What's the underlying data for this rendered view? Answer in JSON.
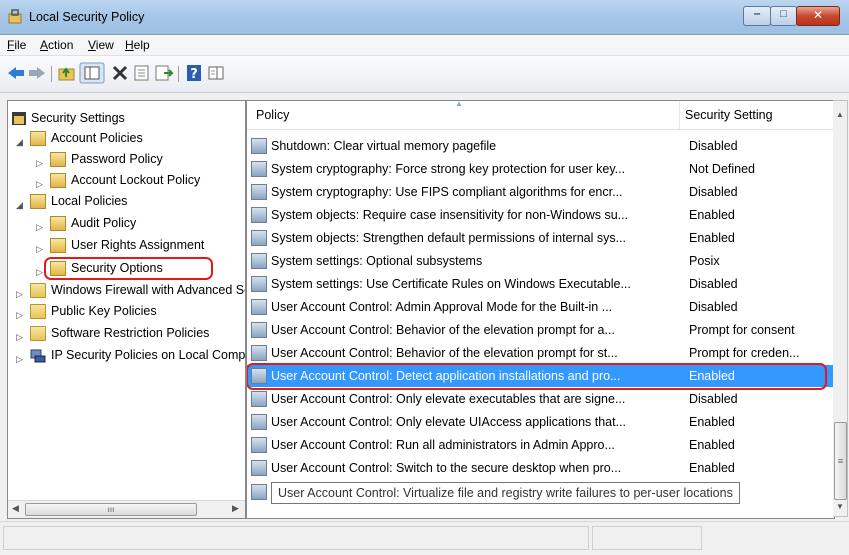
{
  "window": {
    "title": "Local Security Policy",
    "buttons": {
      "minimize": "‒",
      "maximize": "□",
      "close": "✕"
    }
  },
  "menu": [
    {
      "label": "File"
    },
    {
      "label": "Action"
    },
    {
      "label": "View"
    },
    {
      "label": "Help"
    }
  ],
  "toolbar": [
    {
      "icon": "back-arrow-icon"
    },
    {
      "icon": "forward-arrow-icon"
    },
    {
      "icon": "up-folder-icon"
    },
    {
      "icon": "show-hide-tree-icon"
    },
    {
      "icon": "delete-icon"
    },
    {
      "icon": "properties-icon"
    },
    {
      "icon": "export-list-icon"
    },
    {
      "icon": "help-icon"
    },
    {
      "icon": "show-hide-action-pane-icon"
    }
  ],
  "tree": [
    {
      "label": "Security Settings",
      "expander": ""
    },
    {
      "label": "Account Policies",
      "expander": "◢"
    },
    {
      "label": "Password Policy",
      "expander": "▷"
    },
    {
      "label": "Account Lockout Policy",
      "expander": "▷"
    },
    {
      "label": "Local Policies",
      "expander": "◢"
    },
    {
      "label": "Audit Policy",
      "expander": "▷"
    },
    {
      "label": "User Rights Assignment",
      "expander": "▷"
    },
    {
      "label": "Security Options",
      "expander": "▷"
    },
    {
      "label": "Windows Firewall with Advanced Security",
      "expander": "▷"
    },
    {
      "label": "Public Key Policies",
      "expander": "▷"
    },
    {
      "label": "Software Restriction Policies",
      "expander": "▷"
    },
    {
      "label": "IP Security Policies on Local Computer",
      "expander": "▷"
    }
  ],
  "scroll": {
    "hscroll_grip": "ııı",
    "left_arrow": "◀",
    "right_arrow": "▶",
    "up_arrow": "▲",
    "down_arrow": "▼",
    "vgrip": "≡"
  },
  "list": {
    "columns": {
      "policy": "Policy",
      "setting": "Security Setting"
    },
    "rows": [
      {
        "policy": "Shutdown: Clear virtual memory pagefile",
        "setting": "Disabled"
      },
      {
        "policy": "System cryptography: Force strong key protection for user key...",
        "setting": "Not Defined"
      },
      {
        "policy": "System cryptography: Use FIPS compliant algorithms for encr...",
        "setting": "Disabled"
      },
      {
        "policy": "System objects: Require case insensitivity for non-Windows su...",
        "setting": "Enabled"
      },
      {
        "policy": "System objects: Strengthen default permissions of internal sys...",
        "setting": "Enabled"
      },
      {
        "policy": "System settings: Optional subsystems",
        "setting": "Posix"
      },
      {
        "policy": "System settings: Use Certificate Rules on Windows Executable...",
        "setting": "Disabled"
      },
      {
        "policy": "User Account Control: Admin Approval Mode for the Built-in ...",
        "setting": "Disabled"
      },
      {
        "policy": "User Account Control: Behavior of the elevation prompt for a...",
        "setting": "Prompt for consent"
      },
      {
        "policy": "User Account Control: Behavior of the elevation prompt for st...",
        "setting": "Prompt for creden..."
      },
      {
        "policy": "User Account Control: Detect application installations and pro...",
        "setting": "Enabled"
      },
      {
        "policy": "User Account Control: Only elevate executables that are signe...",
        "setting": "Disabled"
      },
      {
        "policy": "User Account Control: Only elevate UIAccess applications that...",
        "setting": "Enabled"
      },
      {
        "policy": "User Account Control: Run all administrators in Admin Appro...",
        "setting": "Enabled"
      },
      {
        "policy": "User Account Control: Switch to the secure desktop when pro...",
        "setting": "Enabled"
      }
    ],
    "tooltip": "User Account Control: Virtualize file and registry write failures to per-user locations"
  },
  "colors": {
    "selection": "#3399ff",
    "highlight_ring": "#e01b1b"
  }
}
